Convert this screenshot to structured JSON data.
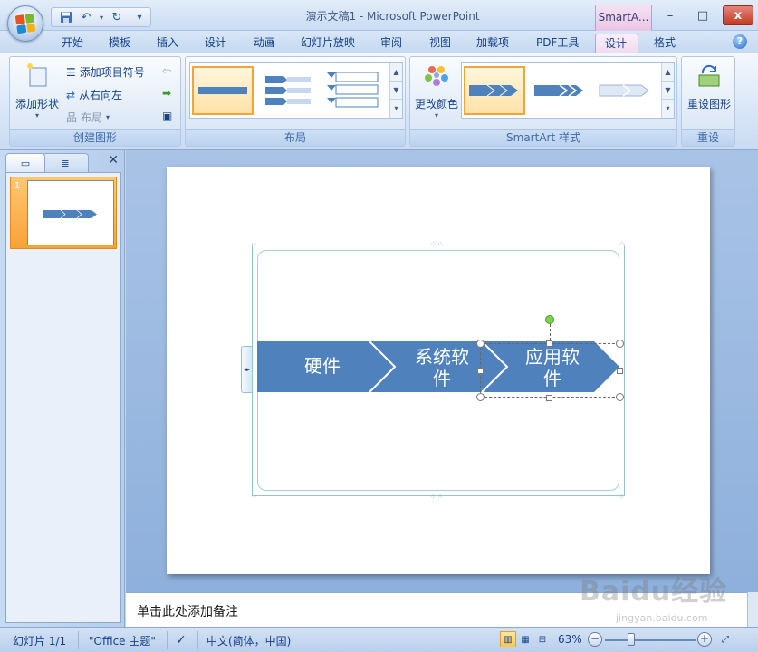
{
  "window": {
    "title": "演示文稿1 - Microsoft PowerPoint",
    "context_tab_header": "SmartA...",
    "minimize": "–",
    "maximize": "□",
    "close": "x"
  },
  "qat": {
    "save_icon": "save-icon",
    "undo_icon": "undo-icon",
    "redo_icon": "redo-icon",
    "more": "▾"
  },
  "tabs": [
    {
      "label": "开始"
    },
    {
      "label": "模板"
    },
    {
      "label": "插入"
    },
    {
      "label": "设计"
    },
    {
      "label": "动画"
    },
    {
      "label": "幻灯片放映"
    },
    {
      "label": "审阅"
    },
    {
      "label": "视图"
    },
    {
      "label": "加载项"
    },
    {
      "label": "PDF工具"
    },
    {
      "label": "设计",
      "active": true,
      "contextual": true
    },
    {
      "label": "格式"
    }
  ],
  "help": "?",
  "ribbon": {
    "create_graphic": {
      "label": "创建图形",
      "add_shape": "添加形状",
      "add_bullet": "添加项目符号",
      "right_to_left": "从右向左",
      "layout": "布局"
    },
    "layouts": {
      "label": "布局"
    },
    "smartart_styles": {
      "label": "SmartArt 样式",
      "change_colors": "更改颜色"
    },
    "reset": {
      "label": "重设",
      "reset_graphic": "重设图形"
    }
  },
  "left_panel": {
    "slide_number": "1",
    "close": "✕"
  },
  "slide": {
    "shapes": [
      {
        "text": "硬件"
      },
      {
        "text": "系统软\n件"
      },
      {
        "text": "应用软\n件"
      }
    ],
    "shape_color": "#4f81bd"
  },
  "notes": {
    "placeholder": "单击此处添加备注"
  },
  "status": {
    "slide_count": "幻灯片 1/1",
    "theme": "\"Office 主题\"",
    "language": "中文(简体，中国)",
    "zoom": "63%"
  },
  "watermark": {
    "text": "Baidu经验",
    "sub": "jingyan.baidu.com"
  }
}
